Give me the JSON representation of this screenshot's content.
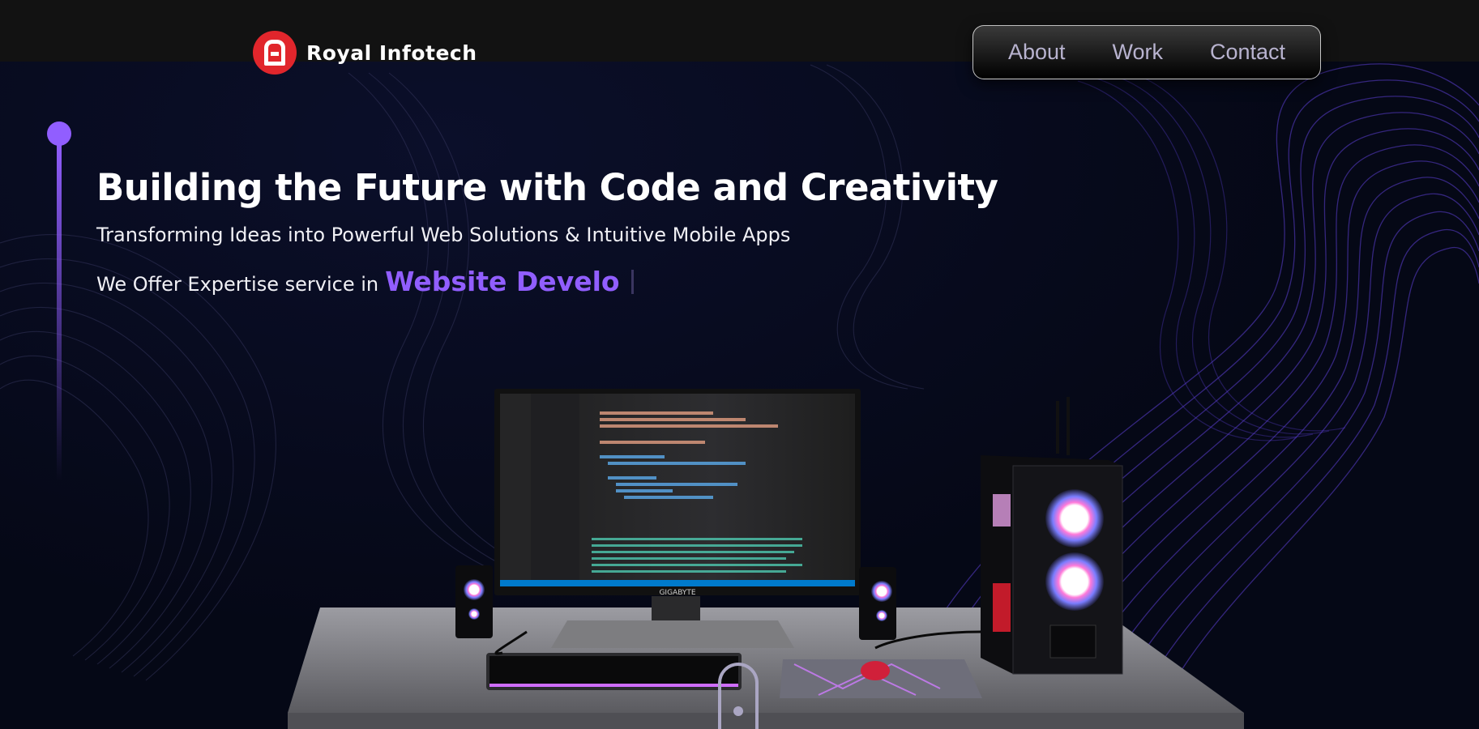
{
  "brand": {
    "name": "Royal Infotech",
    "logo_icon": "royal-infotech-logo-icon",
    "accent": "#e1262c"
  },
  "nav": {
    "items": [
      {
        "label": "About"
      },
      {
        "label": "Work"
      },
      {
        "label": "Contact"
      }
    ]
  },
  "hero": {
    "title": "Building the Future with Code and Creativity",
    "subtitle": "Transforming Ideas into Powerful Web Solutions & Intuitive Mobile Apps",
    "offer_prefix": "We Offer Expertise service in",
    "offer_typed": "Website Develo"
  },
  "monitor": {
    "brand": "GIGABYTE"
  },
  "colors": {
    "accent": "#915eff",
    "background": "#050816",
    "topbar": "#121212"
  }
}
